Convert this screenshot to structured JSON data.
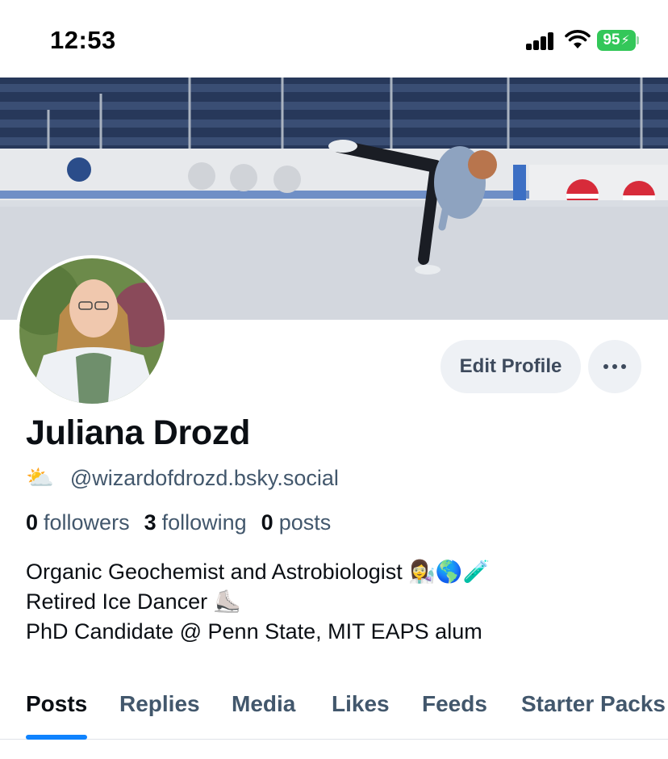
{
  "status_bar": {
    "time": "12:53",
    "battery": "95"
  },
  "profile": {
    "display_name": "Juliana Drozd",
    "handle_emoji": "⛅",
    "handle": "@wizardofdrozd.bsky.social",
    "edit_profile_label": "Edit Profile",
    "more_label": "•••"
  },
  "stats": {
    "followers_count": "0",
    "followers_label": "followers",
    "following_count": "3",
    "following_label": "following",
    "posts_count": "0",
    "posts_label": "posts"
  },
  "bio": {
    "line1": "Organic Geochemist and Astrobiologist 👩‍🔬🌎🧪",
    "line2": "Retired Ice Dancer ⛸️",
    "line3": "PhD Candidate @ Penn State, MIT EAPS alum"
  },
  "tabs": [
    {
      "label": "Posts",
      "active": true
    },
    {
      "label": "Replies",
      "active": false
    },
    {
      "label": "Media",
      "active": false
    },
    {
      "label": "Likes",
      "active": false
    },
    {
      "label": "Feeds",
      "active": false
    },
    {
      "label": "Starter Packs",
      "active": false
    }
  ],
  "colors": {
    "accent": "#1083fe",
    "secondary_text": "#42576c",
    "button_bg": "#eef1f5",
    "battery_green": "#33c759"
  },
  "icons": {
    "signal": "cellular-signal-icon",
    "wifi": "wifi-icon",
    "battery": "battery-charging-icon",
    "more": "ellipsis-icon"
  }
}
